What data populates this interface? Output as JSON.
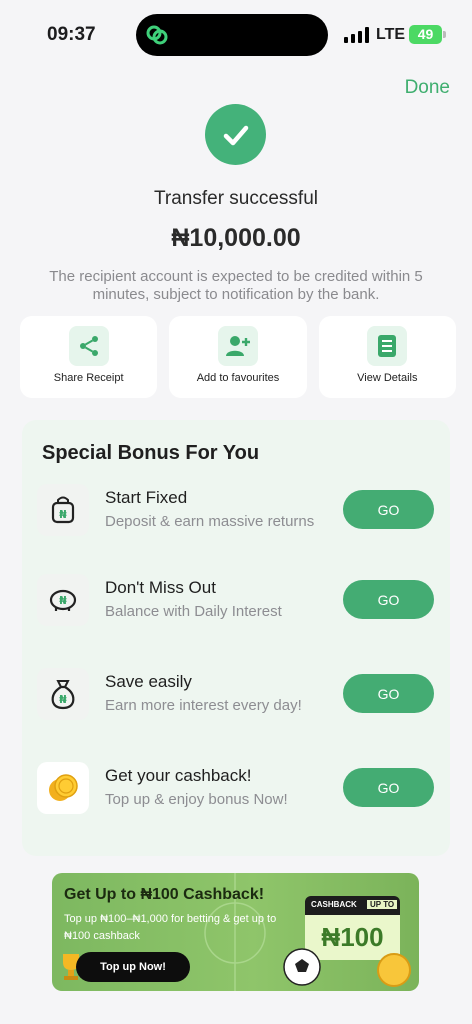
{
  "status_bar": {
    "time": "09:37",
    "network": "LTE",
    "battery": "49"
  },
  "header": {
    "done_label": "Done"
  },
  "result": {
    "title": "Transfer successful",
    "amount": "₦10,000.00",
    "note": "The recipient account is expected to be credited within 5 minutes, subject to notification by the bank."
  },
  "actions": [
    {
      "label": "Share Receipt",
      "icon": "share-icon"
    },
    {
      "label": "Add to favourites",
      "icon": "add-user-icon"
    },
    {
      "label": "View Details",
      "icon": "document-icon"
    }
  ],
  "bonus": {
    "title": "Special Bonus For You",
    "items": [
      {
        "title": "Start Fixed",
        "subtitle": "Deposit & earn massive returns",
        "button": "GO",
        "icon": "lock-bag-icon"
      },
      {
        "title": "Don't Miss Out",
        "subtitle": "Balance with Daily Interest",
        "button": "GO",
        "icon": "piggy-bank-icon"
      },
      {
        "title": "Save easily",
        "subtitle": "Earn more interest every day!",
        "button": "GO",
        "icon": "money-bag-icon"
      },
      {
        "title": "Get your cashback!",
        "subtitle": "Top up & enjoy bonus Now!",
        "button": "GO",
        "icon": "coins-icon"
      }
    ]
  },
  "banner": {
    "title": "Get Up to ₦100 Cashback!",
    "subtitle": "Top up ₦100–₦1,000 for betting & get up to ₦100 cashback",
    "button": "Top up Now!",
    "tag_left": "CASHBACK",
    "tag_right": "UP TO",
    "tag_value": "₦100"
  },
  "colors": {
    "accent": "#44ac73",
    "done": "#3fae6f",
    "bonus_bg": "#eef6f0"
  }
}
